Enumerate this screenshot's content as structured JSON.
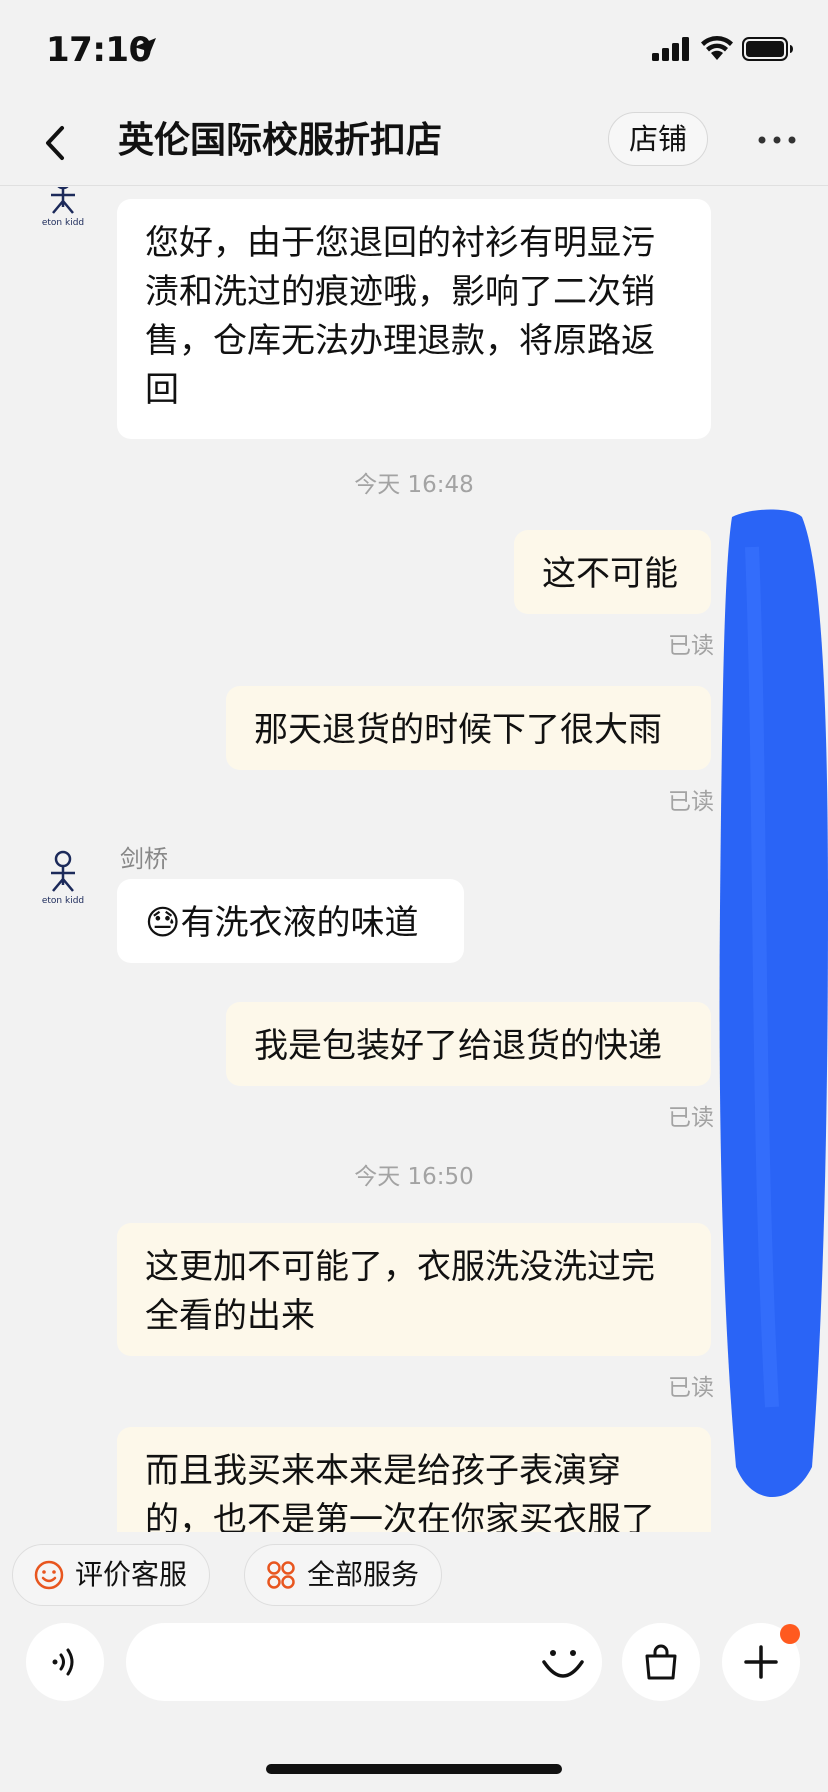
{
  "status_bar": {
    "time": "17:10"
  },
  "header": {
    "title": "英伦国际校服折扣店",
    "store_label": "店铺"
  },
  "messages": {
    "m1": {
      "sender": "",
      "text": "您好，由于您退回的衬衫有明显污渍和洗过的痕迹哦，影响了二次销售，仓库无法办理退款，将原路返回"
    },
    "t1": "今天 16:48",
    "m2": {
      "text": "这不可能",
      "status": "已读"
    },
    "m3": {
      "text": "那天退货的时候下了很大雨",
      "status": "已读"
    },
    "m4": {
      "sender": "剑桥",
      "emoji": "😓",
      "text": "有洗衣液的味道"
    },
    "m5": {
      "text": "我是包装好了给退货的快递",
      "status": "已读"
    },
    "t2": "今天 16:50",
    "m6": {
      "text": "这更加不可能了，衣服洗没洗过完全看的出来",
      "status": "已读"
    },
    "m7": {
      "text": "而且我买来本来是给孩子表演穿的，也不是第一次在你家买衣服了"
    }
  },
  "avatar_brand": "eton kidd",
  "services": {
    "rate_label": "评价客服",
    "all_label": "全部服务"
  },
  "input": {
    "placeholder": ""
  },
  "colors": {
    "accent": "#ff5a1f",
    "outgoing_bubble": "#fdf8ea",
    "incoming_bubble": "#ffffff",
    "redaction": "#1f5cf5"
  }
}
